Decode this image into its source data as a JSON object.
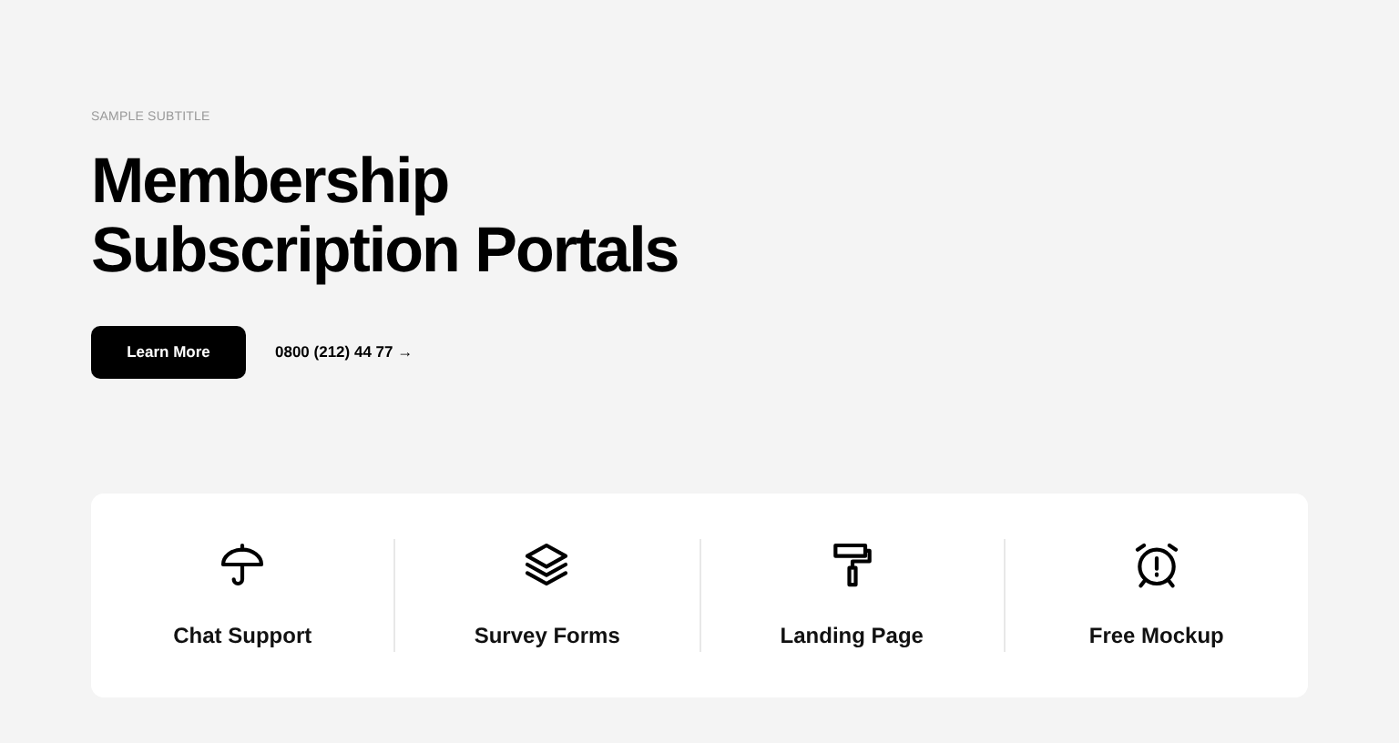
{
  "hero": {
    "subtitle": "SAMPLE SUBTITLE",
    "title_lines": [
      "Membership",
      "Subscription Portals"
    ],
    "button": "Learn More",
    "phone_link": "0800 (212) 44 77 →"
  },
  "features": [
    {
      "kind": "umbrella",
      "label": "Chat Support"
    },
    {
      "kind": "layers",
      "label": "Survey Forms"
    },
    {
      "kind": "roller",
      "label": "Landing Page"
    },
    {
      "kind": "alarm",
      "label": "Free Mockup"
    }
  ]
}
